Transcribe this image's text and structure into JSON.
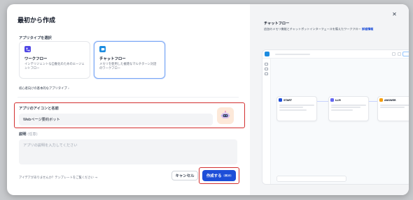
{
  "dialog": {
    "title": "最初から作成",
    "app_type_label": "アプリタイプを選択",
    "types": [
      {
        "name": "ワークフロー",
        "desc_line1": "インテリジェントな自動化のためのエージェ",
        "desc_line2": "ントフロー",
        "icon": "workflow-icon",
        "color": "#4f46e5"
      },
      {
        "name": "チャットフロー",
        "desc_line1": "メモリを使用した複雑なマルチターン対話",
        "desc_line2": "のワークフロー",
        "icon": "chat-icon",
        "color": "#1d8ce0"
      }
    ],
    "beginner_hint": "初心者向けの基本的なアプリタイプ",
    "icon_name_label": "アプリのアイコンと名前",
    "name_value": "Webページ要約ボット",
    "description_label": "説明",
    "description_optional": "(任意)",
    "description_placeholder": "アプリの説明を入力してください",
    "footer_hint": "アイデアがありませんか？テンプレートをご覧ください",
    "cancel_label": "キャンセル",
    "create_label": "作成する",
    "accent": "#1d4ed8",
    "highlight": "#d32f2f"
  },
  "preview": {
    "title": "チャットフロー",
    "desc": "追加のメモリ機能とチャットボットインターフェースを備えたワークフロー",
    "desc_link": "詳細情報",
    "nodes": {
      "start": "START",
      "llm": "LLM",
      "answer": "ANSWER"
    }
  }
}
